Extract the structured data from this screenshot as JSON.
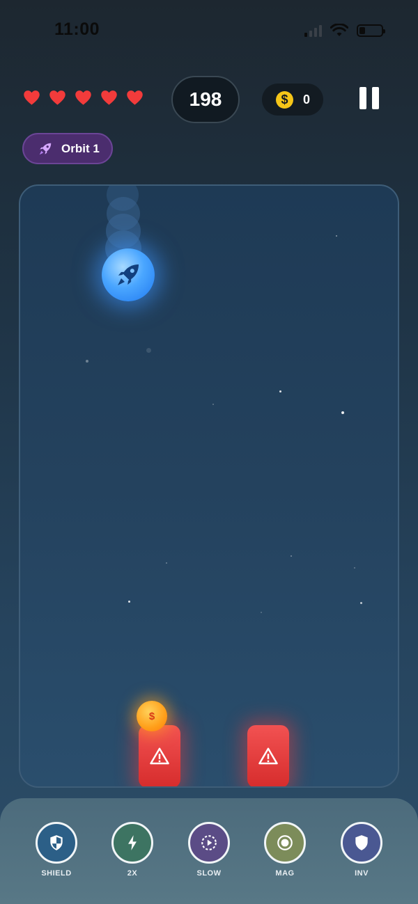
{
  "status_bar": {
    "time": "11:00"
  },
  "hud": {
    "lives": 5,
    "score": "198",
    "coins": "0",
    "heart_color": "#f23b3b",
    "coin_color": "#f5c518"
  },
  "level": {
    "label": "Orbit 1",
    "icon": "rocket-icon",
    "accent": "#4b2d6e"
  },
  "game": {
    "player_icon": "rocket-icon",
    "player_color": "#3d9bff",
    "obstacle_icon": "warning-icon",
    "obstacle_color": "#e33a3a",
    "coin_symbol": "$"
  },
  "powerups": [
    {
      "label": "SHIELD",
      "icon": "shield-half-icon",
      "color": "#2c5f87"
    },
    {
      "label": "2X",
      "icon": "lightning-icon",
      "color": "#3d7462"
    },
    {
      "label": "SLOW",
      "icon": "slow-motion-icon",
      "color": "#5b4c86"
    },
    {
      "label": "MAG",
      "icon": "magnet-target-icon",
      "color": "#7c8c5a"
    },
    {
      "label": "INV",
      "icon": "shield-icon",
      "color": "#4a5892"
    }
  ]
}
